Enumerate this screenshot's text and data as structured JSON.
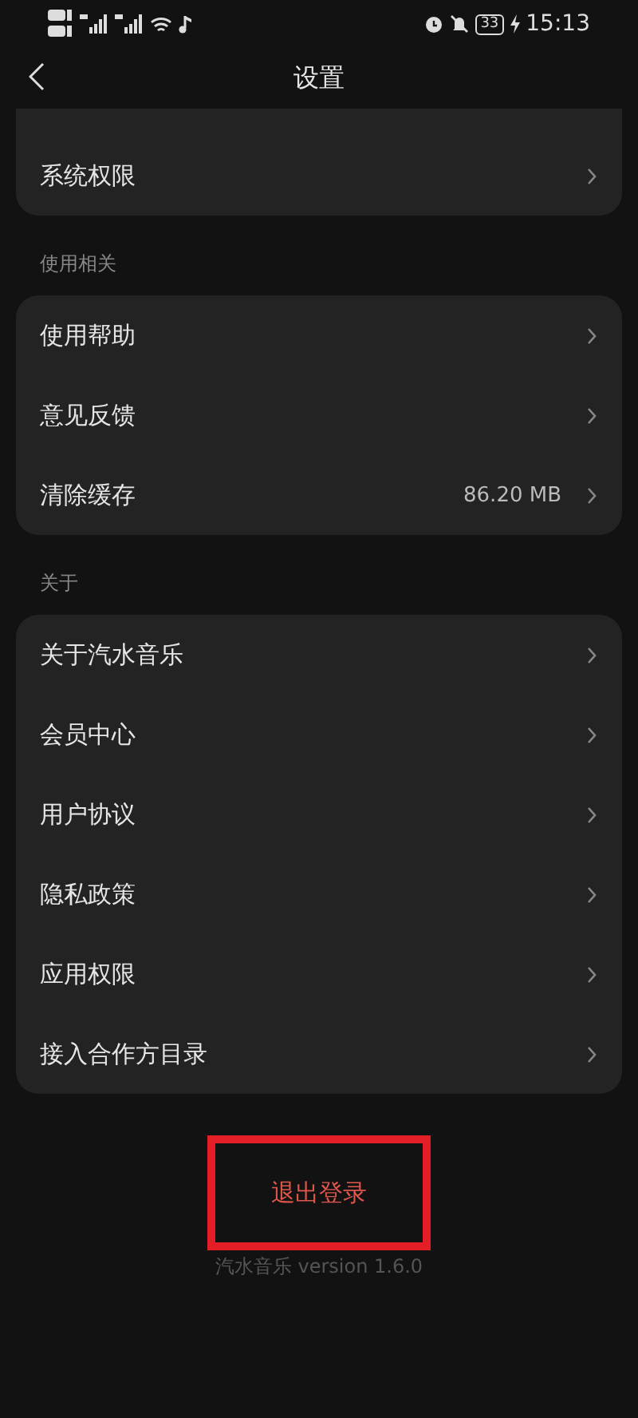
{
  "status_bar": {
    "battery": "33",
    "time": "15:13"
  },
  "header": {
    "title": "设置"
  },
  "sections": [
    {
      "cut_top": true,
      "items": [
        {
          "label": "系统权限"
        }
      ]
    },
    {
      "title": "使用相关",
      "cut_top": false,
      "items": [
        {
          "label": "使用帮助"
        },
        {
          "label": "意见反馈"
        },
        {
          "label": "清除缓存",
          "value": "86.20 MB"
        }
      ]
    },
    {
      "title": "关于",
      "cut_top": false,
      "items": [
        {
          "label": "关于汽水音乐"
        },
        {
          "label": "会员中心"
        },
        {
          "label": "用户协议"
        },
        {
          "label": "隐私政策"
        },
        {
          "label": "应用权限"
        },
        {
          "label": "接入合作方目录"
        }
      ]
    }
  ],
  "logout": {
    "label": "退出登录",
    "highlighted": true
  },
  "version": "汽水音乐 version 1.6.0"
}
